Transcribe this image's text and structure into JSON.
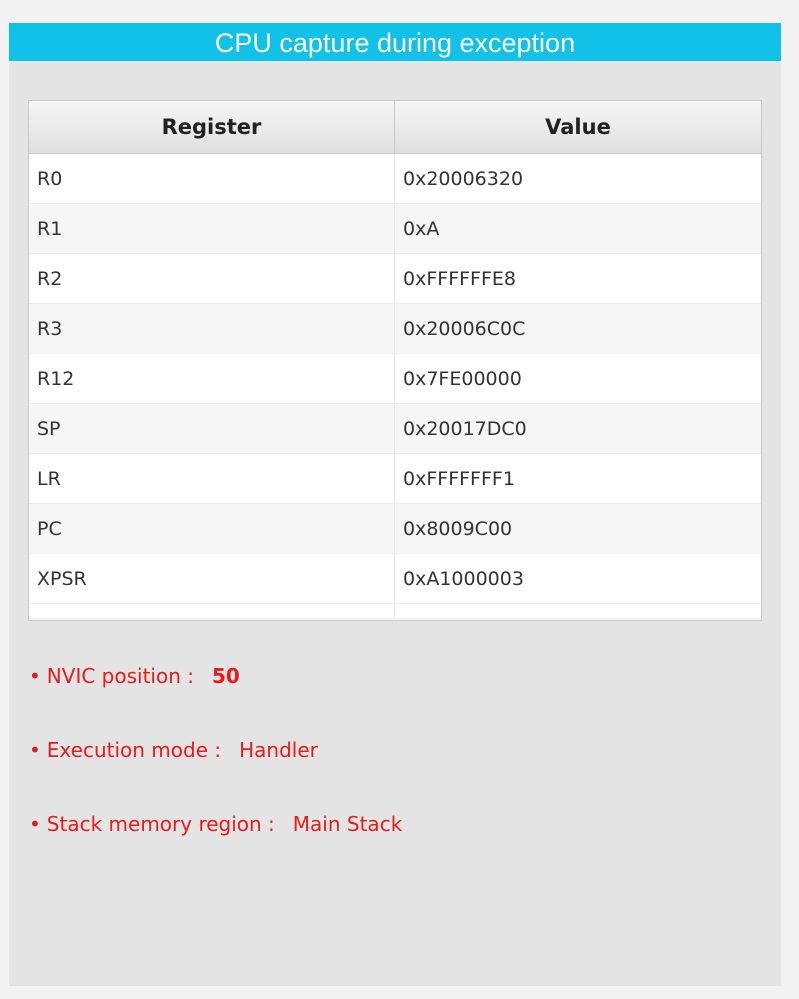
{
  "title": "CPU capture during exception",
  "table": {
    "headers": [
      "Register",
      "Value"
    ],
    "rows": [
      {
        "register": "R0",
        "value": "0x20006320"
      },
      {
        "register": "R1",
        "value": "0xA"
      },
      {
        "register": "R2",
        "value": "0xFFFFFFE8"
      },
      {
        "register": "R3",
        "value": "0x20006C0C"
      },
      {
        "register": "R12",
        "value": "0x7FE00000"
      },
      {
        "register": "SP",
        "value": "0x20017DC0"
      },
      {
        "register": "LR",
        "value": "0xFFFFFFF1"
      },
      {
        "register": "PC",
        "value": "0x8009C00"
      },
      {
        "register": "XPSR",
        "value": "0xA1000003"
      }
    ]
  },
  "info": {
    "bullet": "•",
    "nvic_label": "NVIC position :",
    "nvic_value": "50",
    "mode_label": "Execution mode :",
    "mode_value": "Handler",
    "stack_label": "Stack memory region :",
    "stack_value": "Main Stack"
  },
  "colors": {
    "title_bar": "#12c1e8",
    "info_text": "#e81a1a"
  }
}
